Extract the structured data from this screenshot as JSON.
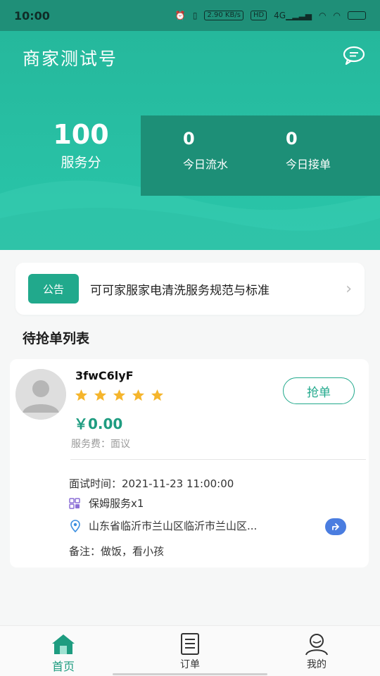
{
  "status_bar": {
    "time": "10:00",
    "icons": [
      "alarm-icon",
      "vibrate-icon",
      "network-speed",
      "hd-icon",
      "4g-signal-icon",
      "wifi-icon",
      "wifi-icon",
      "battery-icon"
    ],
    "network_speed": "2.90 KB/s",
    "hd": "HD",
    "network": "4G",
    "battery": "",
    "colors": {
      "bar": "#1f8f78"
    }
  },
  "header": {
    "title": "商家测试号",
    "service_score": {
      "value": "100",
      "label": "服务分"
    },
    "stats": [
      {
        "value": "0",
        "label": "今日流水"
      },
      {
        "value": "0",
        "label": "今日接单"
      }
    ],
    "chat_icon": "chat-bubble-icon",
    "colors": {
      "bg_top": "#25b89c",
      "bg_bottom": "#2ac6aa",
      "stats_panel": "#1d8f77"
    }
  },
  "notice": {
    "tag": "公告",
    "text": "可可家服家电清洗服务规范与标准",
    "arrow_icon": "chevron-right-icon"
  },
  "section": {
    "title": "待抢单列表"
  },
  "orders": [
    {
      "code": "3fwC6lyF",
      "rating": 5,
      "grab_label": "抢单",
      "price": "￥0.00",
      "fee": "服务费：面议",
      "interview_time": "面试时间：2021-11-23 11:00:00",
      "service": "保姆服务x1",
      "address": "山东省临沂市兰山区临沂市兰山区...",
      "remark": "备注：做饭，看小孩"
    }
  ],
  "bottom_nav": {
    "items": [
      {
        "label": "首页",
        "icon": "home-icon",
        "active": true
      },
      {
        "label": "订单",
        "icon": "order-list-icon",
        "active": false
      },
      {
        "label": "我的",
        "icon": "user-icon",
        "active": false
      }
    ],
    "colors": {
      "active": "#1e9c80"
    }
  }
}
